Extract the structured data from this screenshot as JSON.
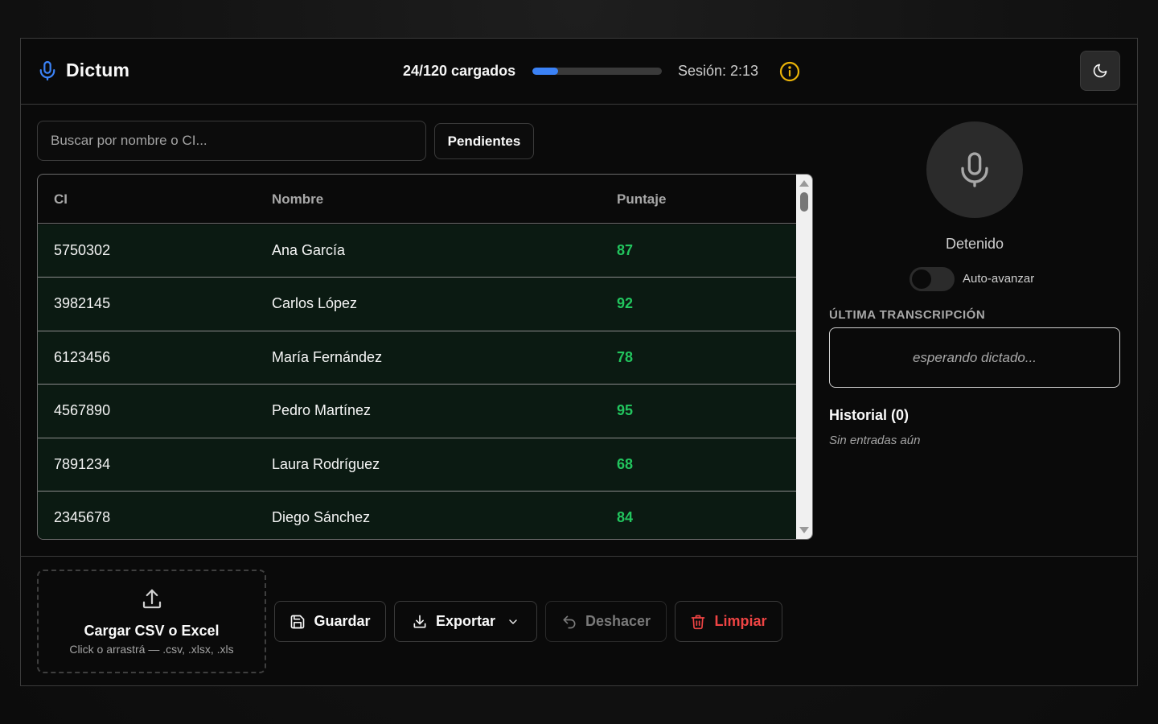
{
  "header": {
    "app_name": "Dictum",
    "loaded_text": "24/120 cargados",
    "progress_fraction": 0.2,
    "session_text": "Sesión: 2:13"
  },
  "search": {
    "placeholder": "Buscar por nombre o CI...",
    "filter_label": "Pendientes"
  },
  "table": {
    "columns": [
      "CI",
      "Nombre",
      "Puntaje"
    ],
    "rows": [
      {
        "ci": "5750302",
        "nombre": "Ana García",
        "puntaje": "87"
      },
      {
        "ci": "3982145",
        "nombre": "Carlos López",
        "puntaje": "92"
      },
      {
        "ci": "6123456",
        "nombre": "María Fernández",
        "puntaje": "78"
      },
      {
        "ci": "4567890",
        "nombre": "Pedro Martínez",
        "puntaje": "95"
      },
      {
        "ci": "7891234",
        "nombre": "Laura Rodríguez",
        "puntaje": "68"
      },
      {
        "ci": "2345678",
        "nombre": "Diego Sánchez",
        "puntaje": "84"
      }
    ]
  },
  "dictation": {
    "status": "Detenido",
    "auto_advance_label": "Auto-avanzar",
    "last_transcription_label": "ÚLTIMA TRANSCRIPCIÓN",
    "transcription_placeholder": "esperando dictado...",
    "history_title": "Historial (0)",
    "history_empty": "Sin entradas aún"
  },
  "footer": {
    "upload_title": "Cargar CSV o Excel",
    "upload_subtitle": "Click o arrastrá — .csv, .xlsx, .xls",
    "save_label": "Guardar",
    "export_label": "Exportar",
    "undo_label": "Deshacer",
    "clear_label": "Limpiar"
  },
  "colors": {
    "accent_blue": "#3b82f6",
    "score_green": "#22c55e",
    "danger_red": "#ef4444",
    "info_yellow": "#eab308"
  }
}
